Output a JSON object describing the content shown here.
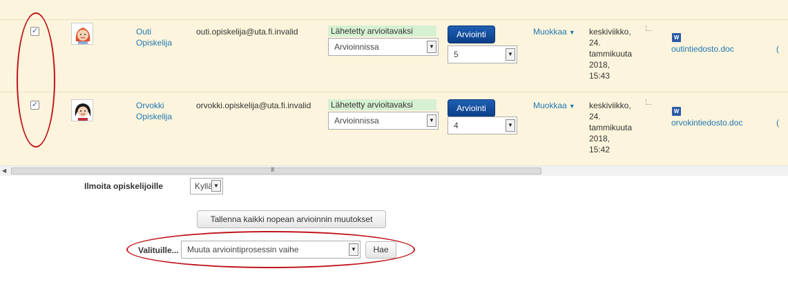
{
  "rows": [
    {
      "checked": "✓",
      "first_name": "Outi",
      "last_name": "Opiskelija",
      "email": "outi.opiskelija@uta.fi.invalid",
      "submission_status": "Lähetetty arvioitavaksi",
      "workflow_state": "Arvioinnissa",
      "grade_button": "Arviointi",
      "grade_value": "5",
      "edit_label": "Muokkaa",
      "date_lines": [
        "keskiviikko,",
        "24.",
        "tammikuuta",
        "2018,",
        "15:43"
      ],
      "file_name": "outintiedosto.doc",
      "edge_text": "("
    },
    {
      "checked": "✓",
      "first_name": "Orvokki",
      "last_name": "Opiskelija",
      "email": "orvokki.opiskelija@uta.fi.invalid",
      "submission_status": "Lähetetty arvioitavaksi",
      "workflow_state": "Arvioinnissa",
      "grade_button": "Arviointi",
      "grade_value": "4",
      "edit_label": "Muokkaa",
      "date_lines": [
        "keskiviikko,",
        "24.",
        "tammikuuta",
        "2018,",
        "15:42"
      ],
      "file_name": "orvokintiedosto.doc",
      "edge_text": "("
    }
  ],
  "scroll_grip": "III",
  "notify": {
    "label": "Ilmoita opiskelijoille",
    "value": "Kyllä"
  },
  "save_button": "Tallenna kaikki nopean arvioinnin muutokset",
  "bulk": {
    "label": "Valituille...",
    "value": "Muuta arviointiprosessin vaihe",
    "go_button": "Hae"
  },
  "icons": {
    "dropdown": "▼",
    "caret": "▼",
    "word_file": "W",
    "scroll_left": "◀"
  },
  "colors": {
    "row_bg": "#fcf4dc",
    "link": "#1f77b4",
    "status_bg": "#d6f0d2",
    "primary_button": "#0a3e86",
    "annotation": "#c0141b"
  }
}
